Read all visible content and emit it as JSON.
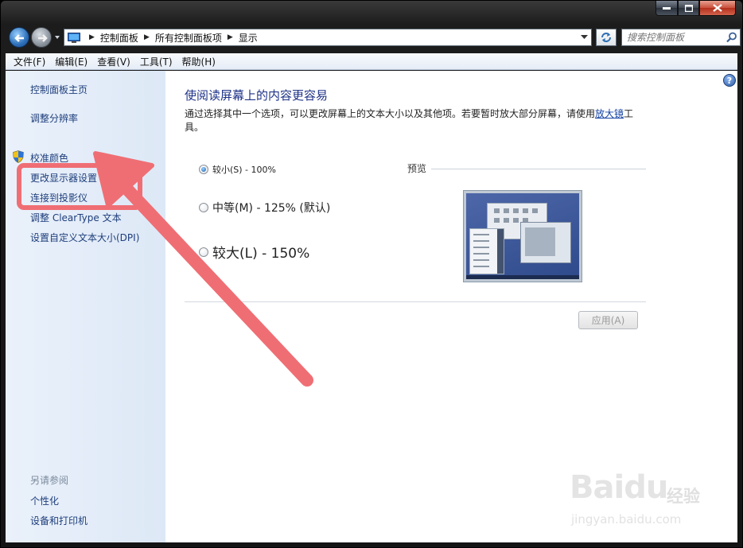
{
  "window": {
    "colors": {
      "highlight": "#ef6e74",
      "link": "#1e3e7b",
      "title": "#1e3287"
    }
  },
  "address": {
    "crumbs": [
      "控制面板",
      "所有控制面板项",
      "显示"
    ]
  },
  "search": {
    "placeholder": "搜索控制面板"
  },
  "menubar": {
    "items": [
      "文件(F)",
      "编辑(E)",
      "查看(V)",
      "工具(T)",
      "帮助(H)"
    ]
  },
  "sidebar": {
    "home": "控制面板主页",
    "resolution": "调整分辨率",
    "calibrate": "校准颜色",
    "change_display": "更改显示器设置",
    "projector": "连接到投影仪",
    "cleartype": "调整 ClearType 文本",
    "dpi": "设置自定义文本大小(DPI)",
    "see_also": "另请参阅",
    "personalize": "个性化",
    "devices": "设备和打印机"
  },
  "main": {
    "title": "使阅读屏幕上的内容更容易",
    "desc_part1": "通过选择其中一个选项，可以更改屏幕上的文本大小以及其他项。若要暂时放大部分屏幕，请使用",
    "desc_link": "放大镜",
    "desc_part2": "工具。",
    "options": [
      {
        "label": "较小(S) - 100%",
        "checked": true
      },
      {
        "label": "中等(M) - 125% (默认)",
        "checked": false
      },
      {
        "label": "较大(L) - 150%",
        "checked": false
      }
    ],
    "preview_label": "预览",
    "apply_label": "应用(A)",
    "help_label": "?"
  },
  "watermark": {
    "brand": "Baidu",
    "cn": "经验",
    "url": "jingyan.baidu.com"
  }
}
